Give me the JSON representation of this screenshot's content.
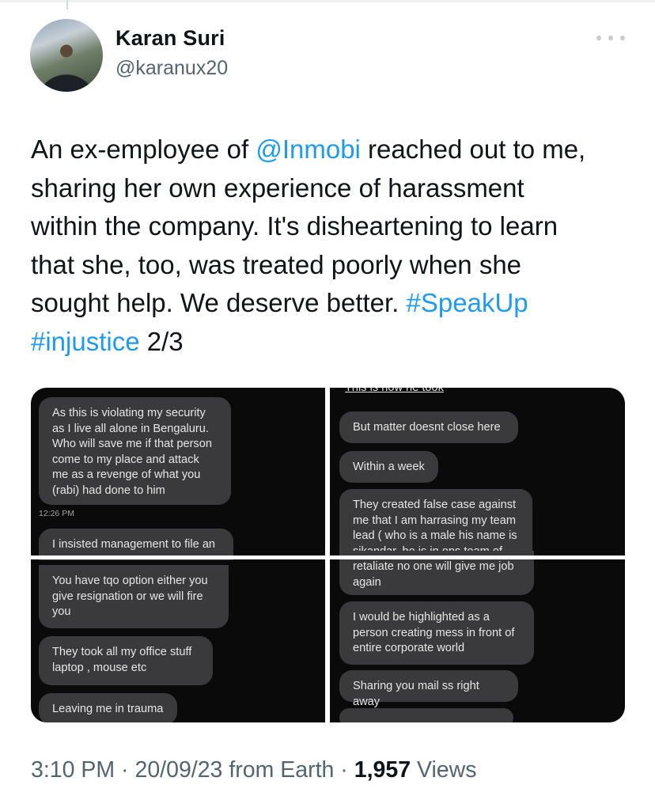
{
  "author": {
    "name": "Karan Suri",
    "handle": "@karanux20"
  },
  "tweet": {
    "text_1": "An ex-employee of ",
    "mention": "@Inmobi",
    "text_2": " reached out to me,\nsharing her own experience of harassment\nwithin the company. It's disheartening to learn\nthat she, too, was treated poorly when she\nsought help. We deserve better. ",
    "hashtag_1": "#SpeakUp",
    "hashtag_2": "#injustice",
    "text_3": " 2/3"
  },
  "media": {
    "panel_top_left": {
      "bubble_1": "As this is violating my security\nas I live all alone in Bengaluru.\nWho will save me if that person\ncome to my place and attack\nme as a revenge of what you\n(rabi) had done to him",
      "timestamp": "12:26 PM",
      "bubble_2_clipped": "I insisted management to file an"
    },
    "panel_top_right": {
      "clipped_top": "This is how he took",
      "bubble_1": "But matter doesnt close here",
      "bubble_2": "Within a week",
      "bubble_3": "They created false case against\nme that I am harrasing my team\nlead ( who is a male his name is\nsikandar, he is in ops team of"
    },
    "panel_bottom_left": {
      "bubble_1": "You have tqo option either you\ngive resignation or we will fire\nyou",
      "bubble_2": "They took all my office stuff\nlaptop , mouse etc",
      "bubble_3": "Leaving me in trauma"
    },
    "panel_bottom_right": {
      "bubble_1": "retaliate no one will give me job\nagain",
      "bubble_2": "I would be highlighted as a\nperson creating mess in front of\nentire corporate world",
      "bubble_3": "Sharing you mail ss right away"
    }
  },
  "footer": {
    "time": "3:10 PM",
    "date": "20/09/23",
    "source": "from Earth",
    "views_count": "1,957",
    "views_label": "Views"
  }
}
